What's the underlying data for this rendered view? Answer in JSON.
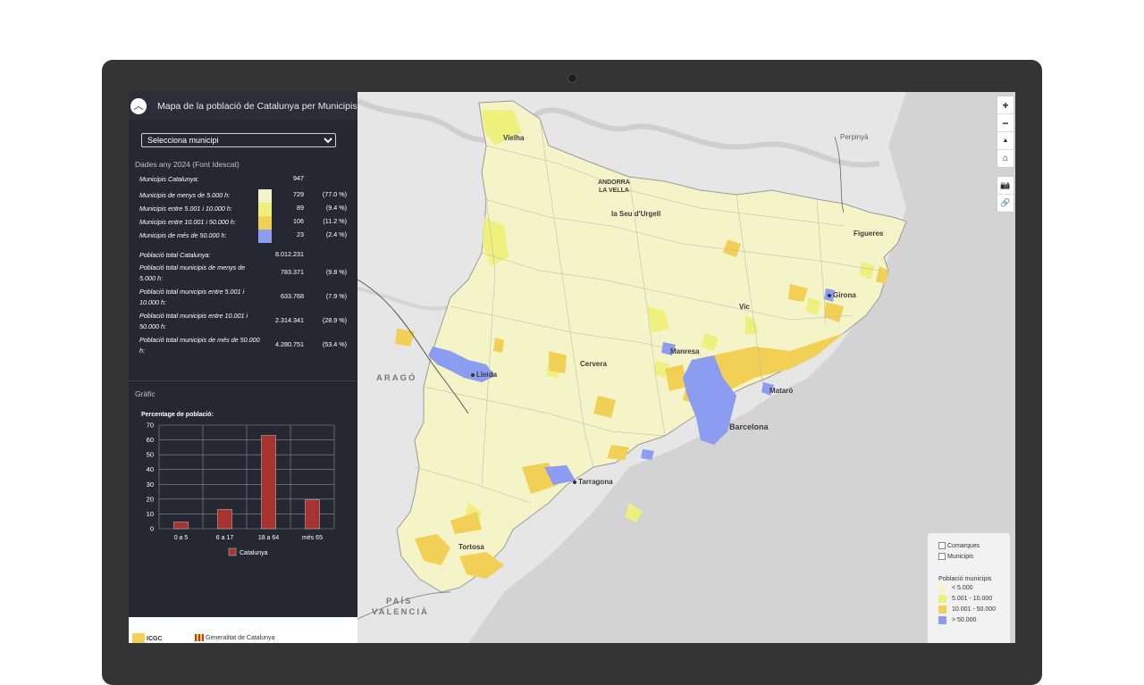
{
  "panel": {
    "title": "Mapa de la població de Catalunya per Municipis",
    "select_value": "Selecciona municipi",
    "data_heading": "Dades any 2024 (Font Idescat)",
    "chart_heading": "Gràfic"
  },
  "stats": {
    "total_label": "Municipis Catalunya:",
    "total_value": "947",
    "rows": [
      {
        "label": "Municipis de menys de 5.000 h:",
        "value": "729",
        "pct": "(77.0 %)",
        "color": "#f4f4c8"
      },
      {
        "label": "Municipis entre 5.001 i 10.000 h:",
        "value": "89",
        "pct": "(9.4 %)",
        "color": "#eef07a"
      },
      {
        "label": "Municipis entre 10.001 i 50.000 h:",
        "value": "106",
        "pct": "(11.2 %)",
        "color": "#f2cf55"
      },
      {
        "label": "Municipis de més de 50.000 h:",
        "value": "23",
        "pct": "(2.4 %)",
        "color": "#8c9cf0"
      }
    ],
    "pop_total_label": "Població total Catalunya:",
    "pop_total_value": "8.012.231",
    "pop_rows": [
      {
        "label": "Població total municipis de menys de 5.000 h:",
        "value": "783.371",
        "pct": "(9.8 %)"
      },
      {
        "label": "Població total municipis entre 5.001 i 10.000 h:",
        "value": "633.768",
        "pct": "(7.9 %)"
      },
      {
        "label": "Població total municipis entre 10.001 i 50.000 h:",
        "value": "2.314.341",
        "pct": "(28.9 %)"
      },
      {
        "label": "Població total municipis de més de 50.000 h:",
        "value": "4.280.751",
        "pct": "(53.4 %)"
      }
    ]
  },
  "chart_data": {
    "type": "bar",
    "title": "Percentage de població:",
    "categories": [
      "0 a 5",
      "6 a 17",
      "18 a 64",
      "més 65"
    ],
    "series": [
      {
        "name": "Catalunya",
        "values": [
          4.5,
          13,
          63,
          19.5
        ],
        "color": "#a7332f"
      }
    ],
    "yticks": [
      0,
      10,
      20,
      30,
      40,
      50,
      60,
      70
    ],
    "ylim": [
      0,
      70
    ],
    "grid": true,
    "legend": "bottom"
  },
  "map": {
    "places": [
      {
        "name": "Vielha"
      },
      {
        "name": "ANDORRA"
      },
      {
        "name": "LA VELLA"
      },
      {
        "name": "la Seu d'Urgell"
      },
      {
        "name": "Perpinyà"
      },
      {
        "name": "Figueres"
      },
      {
        "name": "Girona"
      },
      {
        "name": "Vic"
      },
      {
        "name": "Manresa"
      },
      {
        "name": "Lleida"
      },
      {
        "name": "Cervera"
      },
      {
        "name": "Mataró"
      },
      {
        "name": "Barcelona"
      },
      {
        "name": "Tarragona"
      },
      {
        "name": "Tortosa"
      }
    ],
    "regions": [
      "ARAGÓ",
      "PAÍS",
      "VALENCIÀ"
    ]
  },
  "controls": {
    "zoom_in": "+",
    "zoom_out": "−",
    "north": "▲",
    "home": "⌂",
    "camera": "📷",
    "link": "🔗"
  },
  "legend": {
    "toggle_comarques": "Comarques",
    "toggle_municipis": "Municipis",
    "title": "Població municipis",
    "items": [
      {
        "label": "< 5.000",
        "color": "#f4f4c8"
      },
      {
        "label": "5.001 - 10.000",
        "color": "#eef07a"
      },
      {
        "label": "10.001 - 50.000",
        "color": "#f2cf55"
      },
      {
        "label": "> 50.000",
        "color": "#8c9cf0"
      }
    ]
  },
  "footer": {
    "logo_text": "ICGC",
    "generalitat": "Generalitat de Catalunya"
  }
}
